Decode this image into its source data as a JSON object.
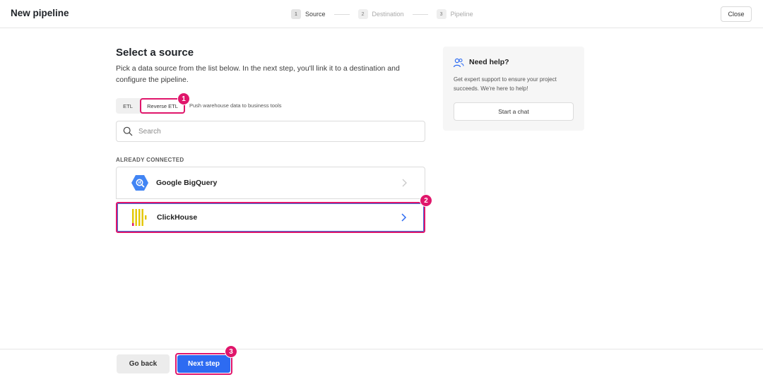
{
  "header": {
    "title": "New pipeline",
    "steps": [
      {
        "num": "1",
        "label": "Source",
        "active": true
      },
      {
        "num": "2",
        "label": "Destination",
        "active": false
      },
      {
        "num": "3",
        "label": "Pipeline",
        "active": false
      }
    ],
    "close_label": "Close"
  },
  "main": {
    "title": "Select a source",
    "description": "Pick a data source from the list below. In the next step, you'll link it to a destination and configure the pipeline.",
    "tabs": [
      {
        "label": "ETL",
        "selected": false
      },
      {
        "label": "Reverse ETL",
        "selected": true
      }
    ],
    "tab_hint": "Push warehouse data to business tools",
    "search": {
      "placeholder": "Search",
      "value": ""
    },
    "section_label": "ALREADY CONNECTED",
    "sources": [
      {
        "name": "Google BigQuery",
        "icon": "bigquery-icon",
        "selected": false
      },
      {
        "name": "ClickHouse",
        "icon": "clickhouse-icon",
        "selected": true
      }
    ]
  },
  "help": {
    "title": "Need help?",
    "text": "Get expert support to ensure your project succeeds. We're here to help!",
    "button_label": "Start a chat",
    "icon": "people-icon"
  },
  "footer": {
    "back_label": "Go back",
    "next_label": "Next step"
  },
  "markers": [
    "1",
    "2",
    "3"
  ],
  "colors": {
    "accent_pink": "#e0166b",
    "primary_blue": "#2d6bf2",
    "bigquery_blue": "#4285f4",
    "clickhouse_yellow": "#faff00"
  }
}
